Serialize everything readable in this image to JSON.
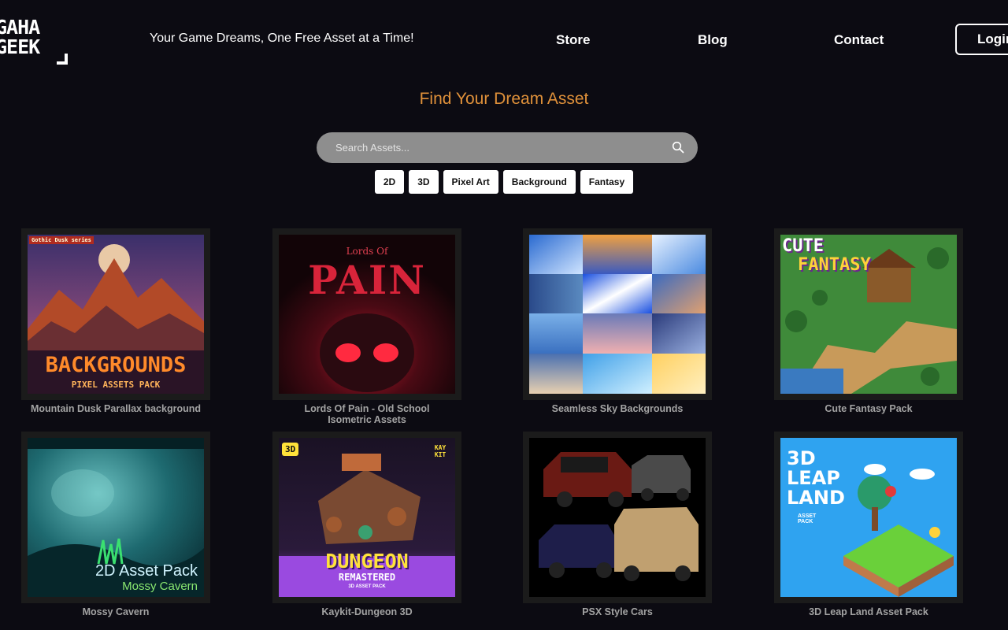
{
  "header": {
    "logo_line1": "GAHA",
    "logo_line2": "GEEK",
    "tagline": "Your Game Dreams, One Free Asset at a Time!",
    "nav": {
      "store": "Store",
      "blog": "Blog",
      "contact": "Contact"
    },
    "login": "Login"
  },
  "search": {
    "title": "Find Your Dream Asset",
    "placeholder": "Search Assets...",
    "tags": [
      "2D",
      "3D",
      "Pixel Art",
      "Background",
      "Fantasy"
    ]
  },
  "assets": [
    {
      "title": "Mountain Dusk Parallax background",
      "art_badge": "Gothic Dusk series",
      "art_title": "BACKGROUNDS",
      "art_subtitle": "PIXEL ASSETS PACK"
    },
    {
      "title": "Lords Of Pain - Old School Isometric Assets",
      "art_small": "Lords Of",
      "art_title": "PAIN"
    },
    {
      "title": "Seamless Sky Backgrounds"
    },
    {
      "title": "Cute Fantasy Pack",
      "art_title1": "CUTE",
      "art_title2": "FANTASY"
    },
    {
      "title": "Mossy Cavern",
      "art_title": "2D Asset Pack",
      "art_subtitle": "Mossy Cavern"
    },
    {
      "title": "Kaykit-Dungeon 3D",
      "art_badge": "3D",
      "art_brand": "KAY KIT",
      "art_title": "DUNGEON",
      "art_subtitle": "REMASTERED",
      "art_small": "3D ASSET PACK"
    },
    {
      "title": "PSX Style Cars"
    },
    {
      "title": "3D Leap Land Asset Pack",
      "art_title": "3D LEAP LAND",
      "art_small": "ASSET PACK"
    }
  ],
  "colors": {
    "background": "#0c0b12",
    "accent": "#e0913a",
    "search_bg": "#8e8e8e",
    "card_bg": "#1b1b1b",
    "label": "#a3a3a3"
  }
}
